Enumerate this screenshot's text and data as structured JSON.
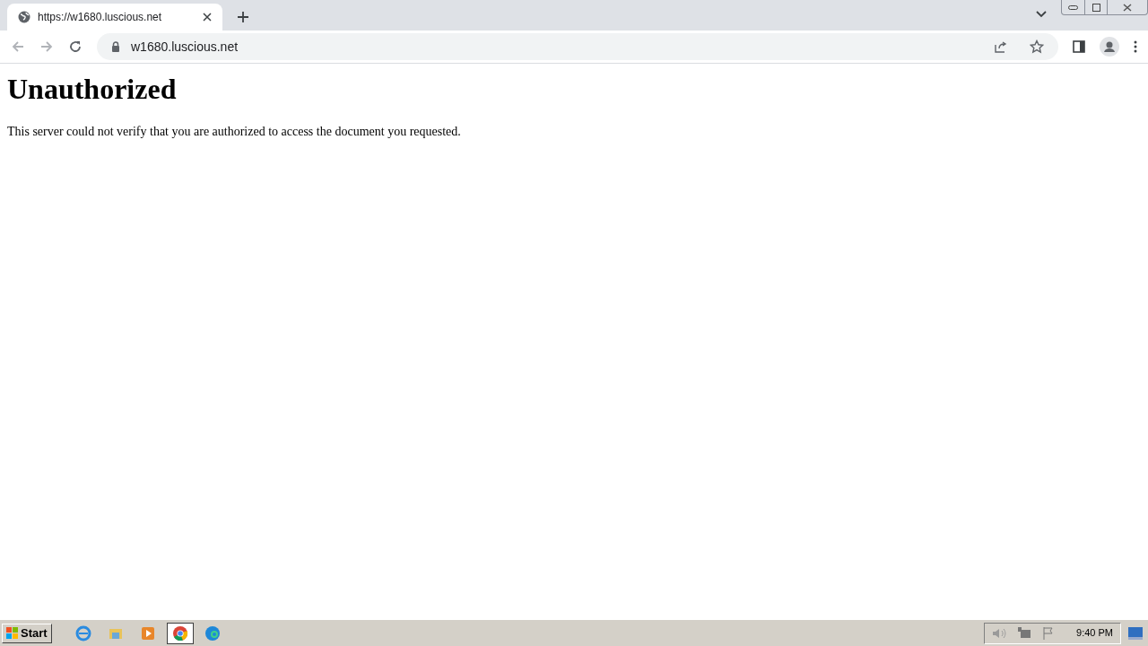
{
  "browser": {
    "tabs": [
      {
        "title": "https://w1680.luscious.net",
        "selected": true
      }
    ],
    "address": "w1680.luscious.net"
  },
  "page": {
    "heading": "Unauthorized",
    "message": "This server could not verify that you are authorized to access the document you requested."
  },
  "taskbar": {
    "start": "Start",
    "apps": [
      {
        "kind": "ie",
        "selected": false
      },
      {
        "kind": "folder",
        "selected": false
      },
      {
        "kind": "media",
        "selected": false
      },
      {
        "kind": "chrome",
        "selected": true
      },
      {
        "kind": "edge",
        "selected": false
      }
    ],
    "clock": "9:40 PM"
  }
}
